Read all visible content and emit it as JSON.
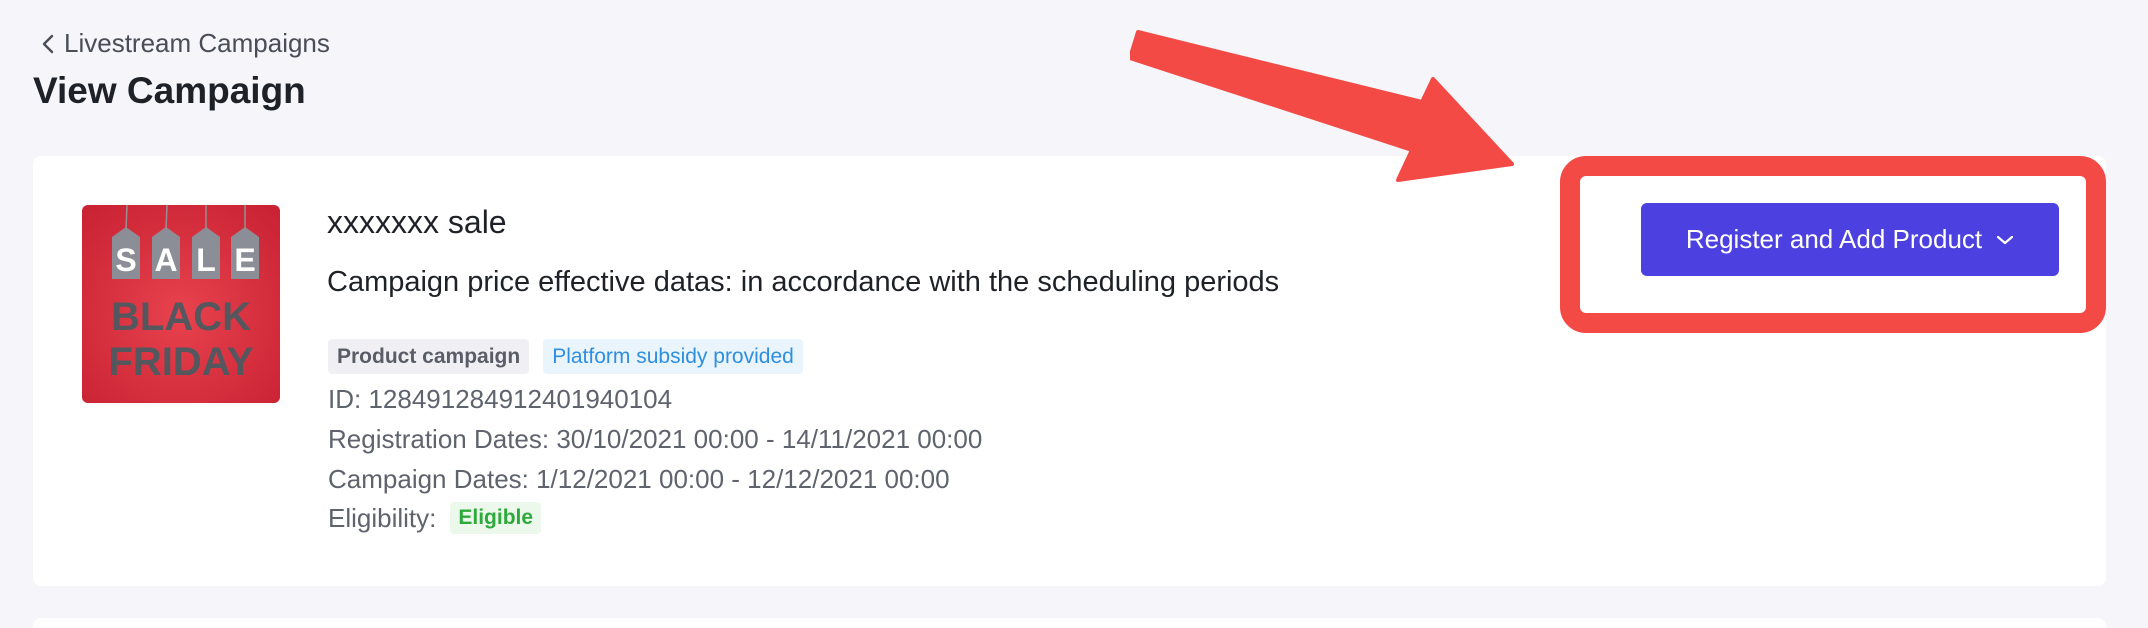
{
  "breadcrumb": {
    "label": "Livestream Campaigns"
  },
  "page": {
    "title": "View Campaign"
  },
  "campaign": {
    "name": "xxxxxxx sale",
    "description": "Campaign price effective datas: in accordance with the scheduling periods",
    "tags": [
      "Product campaign",
      "Platform subsidy provided"
    ],
    "id_text": "ID: 1284912849124019401​04",
    "registration_text": "Registration Dates: 30/10/2021 00:00 - 14/11/2021 00:00",
    "campaign_dates_text": "Campaign Dates: 1/12/2021 00:00 - 12/12/2021 00:00",
    "eligibility_label": "Eligibility:",
    "eligibility_value": "Eligible",
    "image": {
      "sale_letters": [
        "S",
        "A",
        "L",
        "E"
      ],
      "line1": "BLACK",
      "line2": "FRIDAY"
    }
  },
  "actions": {
    "register_label": "Register and Add Product"
  },
  "colors": {
    "primary": "#4c41e0",
    "highlight": "#f34a45",
    "tag_blue": "#2e8fe0",
    "eligible_green": "#2eaa3c"
  }
}
